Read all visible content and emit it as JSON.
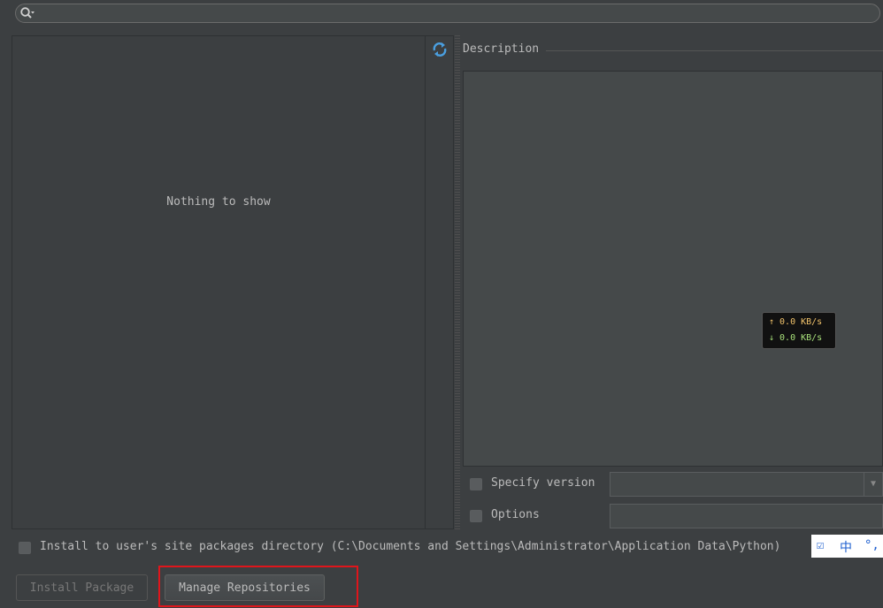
{
  "search": {
    "value": ""
  },
  "packages": {
    "empty_text": "Nothing to show"
  },
  "description": {
    "title": "Description"
  },
  "net_speed": {
    "up": "↑ 0.0 KB/s",
    "down": "↓ 0.0 KB/s"
  },
  "options": {
    "specify_version_label": "Specify version",
    "options_label": "Options"
  },
  "install_user": {
    "label": "Install to user's site packages directory (C:\\Documents and Settings\\Administrator\\Application Data\\Python)"
  },
  "ime": {
    "mode": "中"
  },
  "buttons": {
    "install_label": "Install Package",
    "manage_label": "Manage Repositories"
  },
  "colors": {
    "highlight": "#e0151b",
    "refresh_icon": "#4a9fe0"
  }
}
